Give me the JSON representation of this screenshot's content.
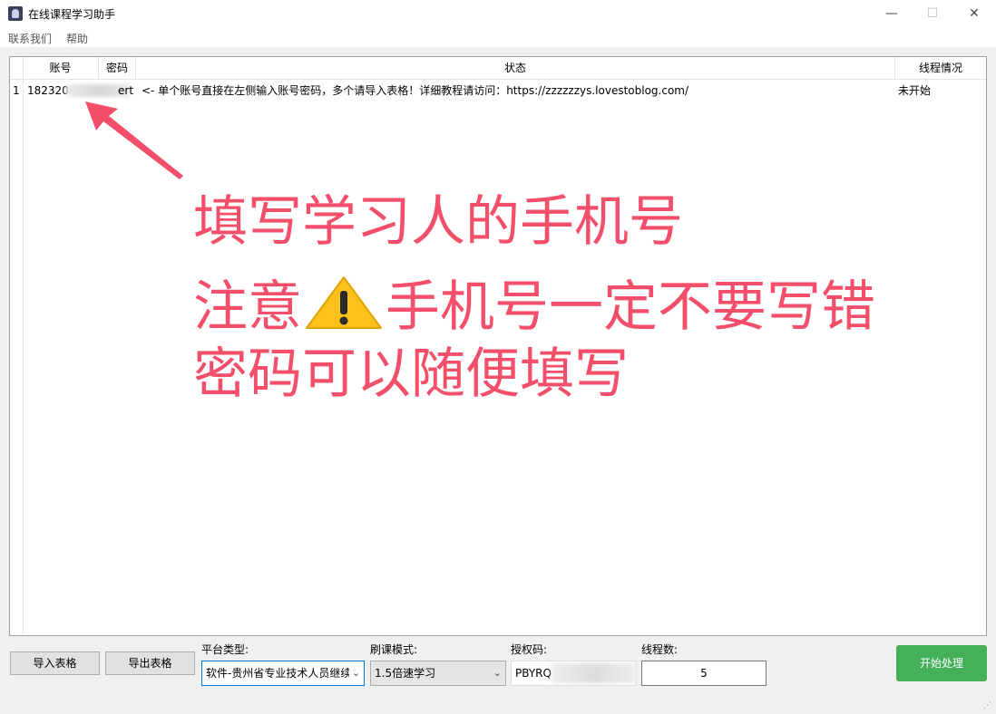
{
  "window": {
    "title": "在线课程学习助手",
    "minimize": "—",
    "maximize": "☐",
    "close": "✕"
  },
  "menu": {
    "items": [
      "联系我们",
      "帮助"
    ]
  },
  "grid": {
    "columns": [
      "账号",
      "密码",
      "状态",
      "线程情况"
    ],
    "rows": [
      {
        "index": "1",
        "account": "182320",
        "password": "ert",
        "status": "<- 单个账号直接在左侧输入账号密码，多个请导入表格！详细教程请访问：https://zzzzzzys.lovestoblog.com/",
        "thread": "未开始"
      }
    ]
  },
  "annotation": {
    "line1": "填写学习人的手机号",
    "line2_a": "注意",
    "line2_b": "手机号一定不要写错",
    "line3": "密码可以随便填写",
    "color": "#f34f6a"
  },
  "controls": {
    "import_label": "导入表格",
    "export_label": "导出表格",
    "platform_label": "平台类型:",
    "platform_value": "软件-贵州省专业技术人员继续",
    "mode_label": "刷课模式:",
    "mode_value": "1.5倍速学习",
    "auth_label": "授权码:",
    "auth_value": "PBYRQ",
    "threads_label": "线程数:",
    "threads_value": "5",
    "start_label": "开始处理",
    "start_color": "#45b05a"
  }
}
